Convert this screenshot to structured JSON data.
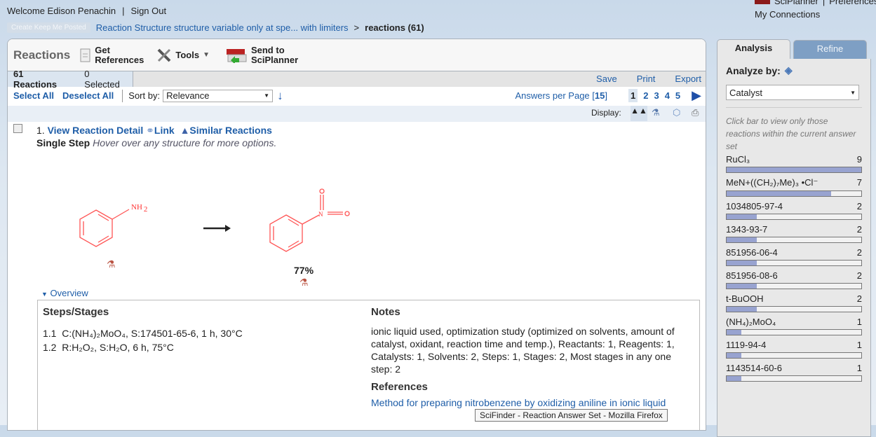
{
  "header": {
    "welcome": "Welcome Edison Penachin",
    "sign_out": "Sign Out",
    "sciplanner": "SciPlanner",
    "preferences": "Preferences",
    "my_connections": "My Connections"
  },
  "breadcrumb": {
    "keep_posted": "Create Keep Me Posted",
    "query": "Reaction Structure structure variable only at spe... with limiters",
    "separator": ">",
    "current": "reactions (61)"
  },
  "toolbar": {
    "title": "Reactions",
    "get_refs_1": "Get",
    "get_refs_2": "References",
    "tools": "Tools",
    "send_1": "Send to",
    "send_2": "SciPlanner"
  },
  "status": {
    "count": "61 Reactions",
    "selected": "0  Selected",
    "save": "Save",
    "print": "Print",
    "export": "Export"
  },
  "sort": {
    "select_all": "Select All",
    "deselect_all": "Deselect All",
    "sort_by": "Sort by:",
    "sort_value": "Relevance",
    "answers_per_page": "Answers per Page [",
    "per_page": "15",
    "close": "]",
    "pages": [
      "1",
      "2",
      "3",
      "4",
      "5"
    ],
    "current_page": "1"
  },
  "display": {
    "label": "Display:"
  },
  "result": {
    "number": "1.",
    "view_detail": "View Reaction Detail",
    "link": "Link",
    "similar": "Similar Reactions",
    "step_type": "Single Step",
    "hover_hint": "Hover over any structure for more options.",
    "reactant_label": "NH",
    "reactant_sub": "2",
    "yield": "77%",
    "overview": "Overview",
    "steps_title": "Steps/Stages",
    "steps": [
      {
        "num": "1.1",
        "text": "C:(NH₄)₂MoO₄, S:174501-65-6, 1 h, 30°C"
      },
      {
        "num": "1.2",
        "text": "R:H₂O₂, S:H₂O, 6 h, 75°C"
      }
    ],
    "notes_title": "Notes",
    "notes": "ionic liquid used, optimization study (optimized on solvents, amount of catalyst, oxidant, reaction time and temp.), Reactants: 1, Reagents: 1, Catalysts: 1, Solvents: 2, Steps: 1, Stages: 2, Most stages in any one step: 2",
    "refs_title": "References",
    "ref_link": "Method for preparing nitrobenzene by oxidizing aniline in ionic liquid",
    "tooltip": "SciFinder - Reaction Answer Set - Mozilla Firefox"
  },
  "analysis": {
    "tab_analysis": "Analysis",
    "tab_refine": "Refine",
    "analyze_by": "Analyze by:",
    "selected": "Catalyst",
    "hint": "Click bar to view only those reactions within the current answer set",
    "max": 9,
    "bar_color": "#98a3d0",
    "items": [
      {
        "label": "RuCl₃",
        "count": 9
      },
      {
        "label": "MeN+((CH₂)₇Me)₃ •Cl⁻",
        "count": 7
      },
      {
        "label": "1034805-97-4",
        "count": 2
      },
      {
        "label": "1343-93-7",
        "count": 2
      },
      {
        "label": "851956-06-4",
        "count": 2
      },
      {
        "label": "851956-08-6",
        "count": 2
      },
      {
        "label": "t-BuOOH",
        "count": 2
      },
      {
        "label": "(NH₄)₂MoO₄",
        "count": 1
      },
      {
        "label": "1119-94-4",
        "count": 1
      },
      {
        "label": "1143514-60-6",
        "count": 1
      }
    ]
  }
}
